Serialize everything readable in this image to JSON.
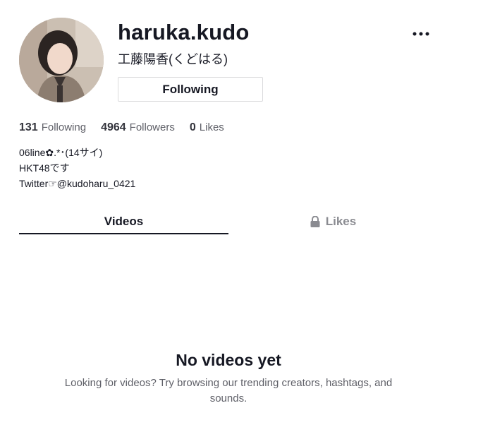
{
  "profile": {
    "username": "haruka.kudo",
    "nickname": "工藤陽香(くどはる)",
    "follow_button_label": "Following",
    "more_icon": "more-horizontal-icon"
  },
  "stats": {
    "following_count": "131",
    "following_label": "Following",
    "followers_count": "4964",
    "followers_label": "Followers",
    "likes_count": "0",
    "likes_label": "Likes"
  },
  "bio": [
    "06line✿.*･(14サイ)",
    "HKT48です",
    "Twitter☞@kudoharu_0421"
  ],
  "tabs": {
    "videos_label": "Videos",
    "likes_label": "Likes",
    "likes_icon": "lock-icon",
    "active": "Videos"
  },
  "empty_state": {
    "title": "No videos yet",
    "description": "Looking for videos? Try browsing our trending creators, hashtags, and sounds."
  }
}
